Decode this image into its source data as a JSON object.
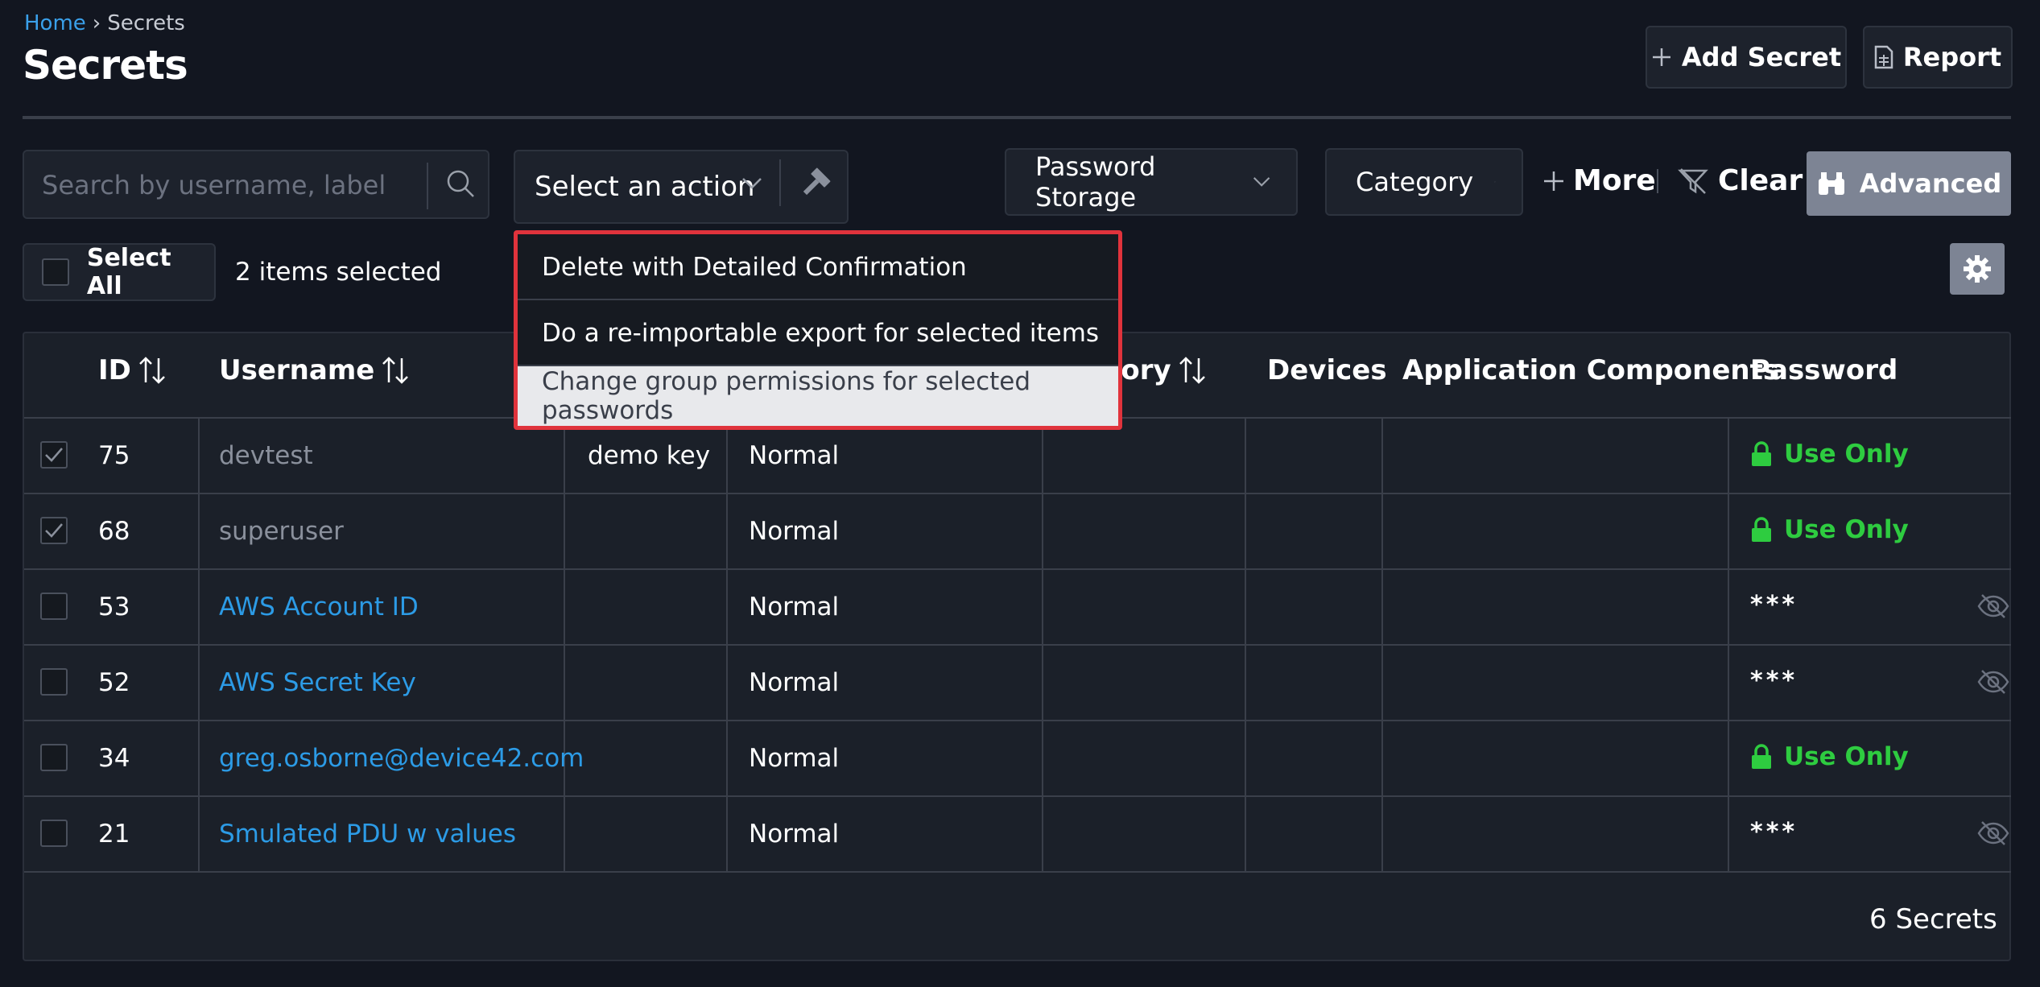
{
  "breadcrumb": {
    "home": "Home",
    "separator": "›",
    "current": "Secrets"
  },
  "page_title": "Secrets",
  "header_actions": {
    "add_secret": "Add Secret",
    "report": "Report"
  },
  "filters": {
    "search_placeholder": "Search by username, label",
    "action_select": "Select an action",
    "password_storage": "Password Storage",
    "category": "Category",
    "more": "More",
    "clear": "Clear",
    "advanced": "Advanced"
  },
  "selection": {
    "select_all": "Select All",
    "count_text": "2 items selected"
  },
  "action_menu": {
    "items": [
      "Delete with Detailed Confirmation",
      "Do a re-importable export for selected items",
      "Change group permissions for selected passwords"
    ],
    "highlighted_index": 2
  },
  "table": {
    "columns": {
      "id": "ID",
      "username": "Username",
      "category_partial": "gory",
      "devices": "Devices",
      "app_components": "Application Components",
      "password": "Password"
    },
    "rows": [
      {
        "checked": true,
        "id": "75",
        "username": "devtest",
        "label": "demo key",
        "storage": "Normal",
        "password": "Use Only"
      },
      {
        "checked": true,
        "id": "68",
        "username": "superuser",
        "label": "",
        "storage": "Normal",
        "password": "Use Only"
      },
      {
        "checked": false,
        "id": "53",
        "username": "AWS Account ID",
        "label": "",
        "storage": "Normal",
        "password": "***"
      },
      {
        "checked": false,
        "id": "52",
        "username": "AWS Secret Key",
        "label": "",
        "storage": "Normal",
        "password": "***"
      },
      {
        "checked": false,
        "id": "34",
        "username": "greg.osborne@device42.com",
        "label": "",
        "storage": "Normal",
        "password": "Use Only"
      },
      {
        "checked": false,
        "id": "21",
        "username": "Smulated PDU w values",
        "label": "",
        "storage": "Normal",
        "password": "***"
      }
    ],
    "footer_count": "6 Secrets"
  },
  "colors": {
    "background": "#121620",
    "link": "#2c9be6",
    "use_only": "#2ecc40",
    "dropdown_border": "#e0333c",
    "button_gray": "#7d8494"
  }
}
